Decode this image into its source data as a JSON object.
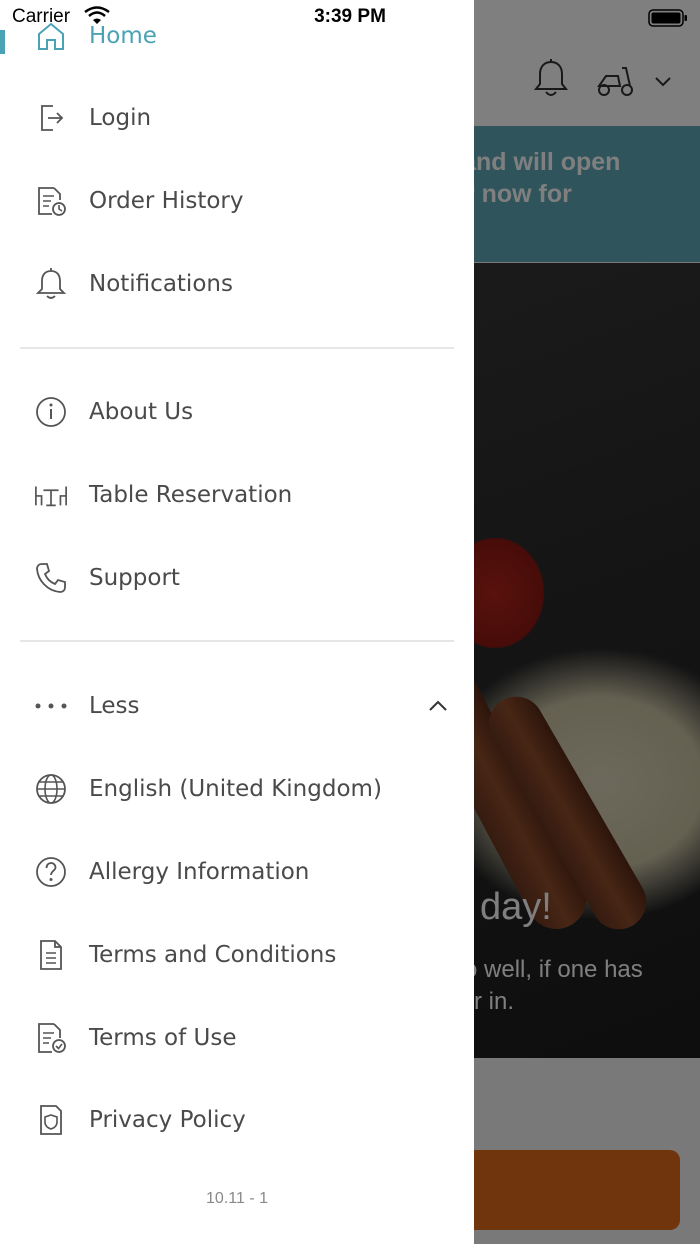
{
  "status_bar": {
    "carrier": "Carrier",
    "time": "3:39 PM"
  },
  "background": {
    "banner_lines": [
      "ed and will open",
      "rder now for"
    ],
    "hero_title": "day!",
    "hero_sub_lines": [
      "o well, if one has",
      "r in."
    ],
    "accent_color": "#e36a1d",
    "banner_color": "#5fa9b8"
  },
  "drawer": {
    "active_color": "#4aa3b5",
    "items": [
      {
        "label": "Home",
        "icon": "home-icon",
        "active": true
      },
      {
        "label": "Login",
        "icon": "login-icon"
      },
      {
        "label": "Order History",
        "icon": "order-history-icon"
      },
      {
        "label": "Notifications",
        "icon": "bell-icon"
      },
      {
        "label": "About Us",
        "icon": "info-icon"
      },
      {
        "label": "Table Reservation",
        "icon": "table-icon"
      },
      {
        "label": "Support",
        "icon": "phone-icon"
      },
      {
        "label": "Less",
        "icon": "more-dots-icon"
      },
      {
        "label": "English (United Kingdom)",
        "icon": "globe-icon"
      },
      {
        "label": "Allergy Information",
        "icon": "question-icon"
      },
      {
        "label": "Terms and Conditions",
        "icon": "document-list-icon"
      },
      {
        "label": "Terms of Use",
        "icon": "document-check-icon"
      },
      {
        "label": "Privacy Policy",
        "icon": "shield-icon"
      }
    ],
    "version": "10.11 - 1"
  }
}
